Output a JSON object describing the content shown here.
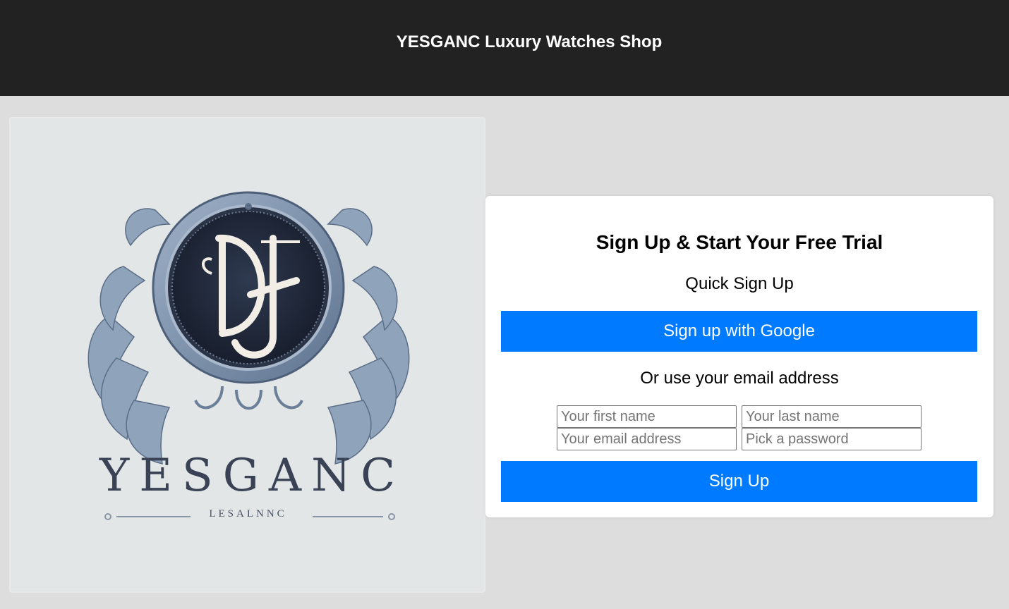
{
  "header": {
    "title": "YESGANC Luxury Watches Shop"
  },
  "logo": {
    "brand": "YESGANC",
    "subtitle": "LESALNNC",
    "monogram": "DJ"
  },
  "signup": {
    "title": "Sign Up & Start Your Free Trial",
    "quick_label": "Quick Sign Up",
    "google_button": "Sign up with Google",
    "or_label": "Or use your email address",
    "fields": {
      "first_name_placeholder": "Your first name",
      "last_name_placeholder": "Your last name",
      "email_placeholder": "Your email address",
      "password_placeholder": "Pick a password"
    },
    "submit_button": "Sign Up"
  },
  "colors": {
    "header_bg": "#222222",
    "page_bg": "#dddddd",
    "accent": "#007bff"
  }
}
